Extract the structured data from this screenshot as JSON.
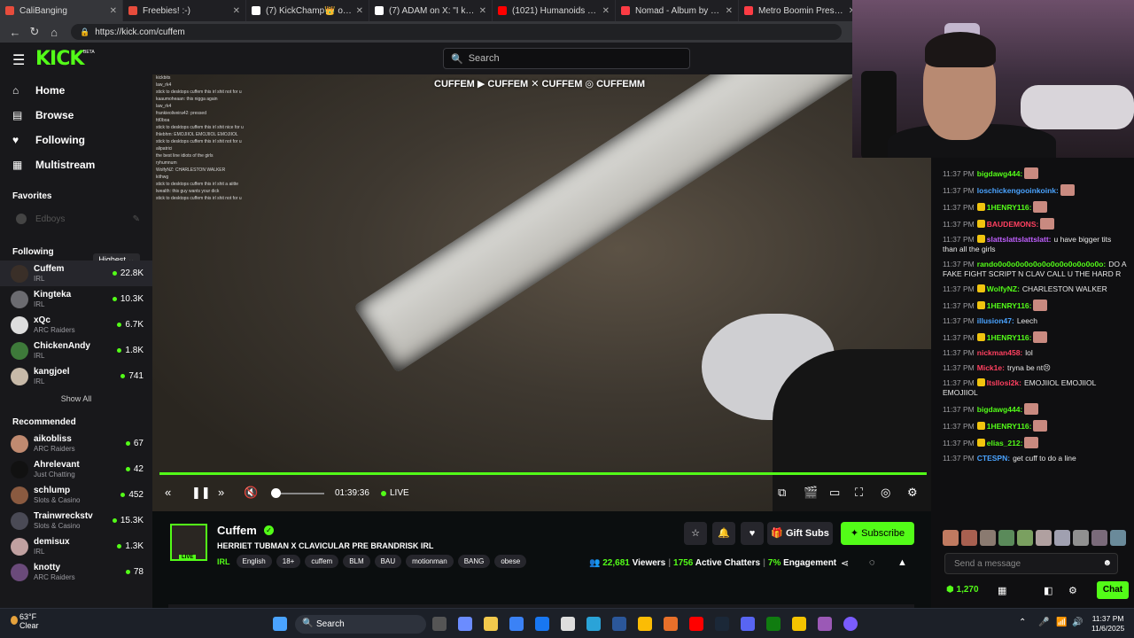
{
  "browser": {
    "tabs": [
      {
        "title": "CaliBanging",
        "color": "#e74c3c"
      },
      {
        "title": "Freebies! :-)",
        "color": "#e74c3c"
      },
      {
        "title": "(7) KickChamp👑 on X: \"A",
        "color": "#ffffff"
      },
      {
        "title": "(7) ADAM on X: \"I knew pe",
        "color": "#ffffff"
      },
      {
        "title": "(1021) Humanoids Cost as",
        "color": "#ff0000"
      },
      {
        "title": "Nomad - Album by DJ Snak",
        "color": "#fc3c44"
      },
      {
        "title": "Metro Boomin Present",
        "color": "#fc3c44"
      }
    ],
    "url": "https://kick.com/cuffem"
  },
  "header": {
    "logo": "KICK",
    "beta": "BETA",
    "search_placeholder": "Search"
  },
  "sidebar": {
    "nav": [
      {
        "label": "Home",
        "icon": "home-icon"
      },
      {
        "label": "Browse",
        "icon": "browse-icon"
      },
      {
        "label": "Following",
        "icon": "heart-icon"
      },
      {
        "label": "Multistream",
        "icon": "grid-icon"
      }
    ],
    "favorites_heading": "Favorites",
    "favorites": [
      {
        "name": "Edboys"
      }
    ],
    "following_heading": "Following",
    "sort_label": "Highest",
    "following": [
      {
        "name": "Cuffem",
        "category": "IRL",
        "viewers": "22.8K",
        "color": "#3a2f28"
      },
      {
        "name": "Kingteka",
        "category": "IRL",
        "viewers": "10.3K",
        "color": "#6b6b70"
      },
      {
        "name": "xQc",
        "category": "ARC Raiders",
        "viewers": "6.7K",
        "color": "#dddddd"
      },
      {
        "name": "ChickenAndy",
        "category": "IRL",
        "viewers": "1.8K",
        "color": "#3e7a3a"
      },
      {
        "name": "kangjoel",
        "category": "IRL",
        "viewers": "741",
        "color": "#c7b9a8"
      }
    ],
    "show_all": "Show All",
    "recommended_heading": "Recommended",
    "recommended": [
      {
        "name": "aikobliss",
        "category": "ARC Raiders",
        "viewers": "67",
        "color": "#c08a70"
      },
      {
        "name": "Ahrelevant",
        "category": "Just Chatting",
        "viewers": "42",
        "color": "#111111"
      },
      {
        "name": "schlump",
        "category": "Slots & Casino",
        "viewers": "452",
        "color": "#8a5a40"
      },
      {
        "name": "Trainwreckstv",
        "category": "Slots & Casino",
        "viewers": "15.3K",
        "color": "#4a4a55"
      },
      {
        "name": "demisux",
        "category": "IRL",
        "viewers": "1.3K",
        "color": "#c0a0a0"
      },
      {
        "name": "knotty",
        "category": "ARC Raiders",
        "viewers": "78",
        "color": "#6a4a7a"
      }
    ]
  },
  "video": {
    "watermark": "CUFFEM ▶ CUFFEM ✕ CUFFEM ◎ CUFFEMM",
    "overlay_lines": [
      "kickbits",
      "law_rk4",
      "stick to desktops cuffem this irl shit not for u",
      "kaaumoheaan: this nigga again",
      "law_rk4",
      "frankieoliveira42: pressed",
      "fd0boa",
      "stick to desktops cuffem this irl shit nice for u",
      "lhlebhm: EMOJIIOL EMOJIIOL EMOJIIOL",
      "stick to desktops cuffem this irl shit not for u",
      "alipatrici",
      "the best line idiots of the girls",
      "ryhumnum",
      "WolfyNZ: CHARLESTON WALKER",
      "kithwg",
      "stick to desktops cuffem this irl shit a aiitte",
      "lwealth: this guy wants your dick",
      "stick to desktops cuffem this irl shit not for u"
    ],
    "time": "01:39:36",
    "live_label": "LIVE",
    "progress": 1.0,
    "volume": 0.0
  },
  "chat": {
    "messages": [
      {
        "time": "11:37 PM",
        "user": "bigdawg444:",
        "color": "#53fc18",
        "text": "",
        "badge": false,
        "emote": true
      },
      {
        "time": "11:37 PM",
        "user": "loschickengooinkoink:",
        "color": "#4aa3ff",
        "text": "",
        "badge": false,
        "emote": true
      },
      {
        "time": "11:37 PM",
        "user": "1HENRY116:",
        "color": "#53fc18",
        "text": "",
        "badge": true,
        "emote": true
      },
      {
        "time": "11:37 PM",
        "user": "BAUDEMONS:",
        "color": "#ff4060",
        "text": "",
        "badge": true,
        "emote": true
      },
      {
        "time": "11:37 PM",
        "user": "slattslattslattslatt:",
        "color": "#c060ff",
        "text": "u have bigger tits than all the girls",
        "badge": true,
        "emote": false
      },
      {
        "time": "11:37 PM",
        "user": "rando0o0o0o0o0o0o0o0o0o0o0o0o:",
        "color": "#53fc18",
        "text": "DO A FAKE FIGHT SCRIPT N CLAV CALL U THE HARD R",
        "badge": false,
        "emote": false
      },
      {
        "time": "11:37 PM",
        "user": "WolfyNZ:",
        "color": "#53fc18",
        "text": "CHARLESTON WALKER",
        "badge": true,
        "emote": false
      },
      {
        "time": "11:37 PM",
        "user": "1HENRY116:",
        "color": "#53fc18",
        "text": "",
        "badge": true,
        "emote": true
      },
      {
        "time": "11:37 PM",
        "user": "illusion47:",
        "color": "#4aa3ff",
        "text": "Leech",
        "badge": false,
        "emote": false
      },
      {
        "time": "11:37 PM",
        "user": "1HENRY116:",
        "color": "#53fc18",
        "text": "",
        "badge": true,
        "emote": true
      },
      {
        "time": "11:37 PM",
        "user": "nickman458:",
        "color": "#ff4060",
        "text": "lol",
        "badge": false,
        "emote": false
      },
      {
        "time": "11:37 PM",
        "user": "Mick1e:",
        "color": "#ff4060",
        "text": "tryna be nt😣",
        "badge": false,
        "emote": false
      },
      {
        "time": "11:37 PM",
        "user": "Itsllosi2k:",
        "color": "#ff4060",
        "text": "EMOJIIOL EMOJIIOL EMOJIIOL",
        "badge": true,
        "emote": false
      },
      {
        "time": "11:37 PM",
        "user": "bigdawg444:",
        "color": "#53fc18",
        "text": "",
        "badge": false,
        "emote": true
      },
      {
        "time": "11:37 PM",
        "user": "1HENRY116:",
        "color": "#53fc18",
        "text": "",
        "badge": true,
        "emote": true
      },
      {
        "time": "11:37 PM",
        "user": "elias_212:",
        "color": "#53fc18",
        "text": "",
        "badge": true,
        "emote": true
      },
      {
        "time": "11:37 PM",
        "user": "CTESPN:",
        "color": "#4aa3ff",
        "text": "get cuff to do a line",
        "badge": false,
        "emote": false
      }
    ],
    "send_placeholder": "Send a message",
    "points": "1,270",
    "chat_button": "Chat"
  },
  "stream": {
    "name": "Cuffem",
    "live_tag": "LIVE",
    "title": "HERRIET TUBMAN X CLAVICULAR PRE BRANDRISK IRL",
    "category": "IRL",
    "tags": [
      "English",
      "18+",
      "cuffem",
      "BLM",
      "BAU",
      "motionman",
      "BANG",
      "obese"
    ],
    "gift_subs": "Gift Subs",
    "subscribe": "Subscribe",
    "viewers": "22,681",
    "viewers_label": "Viewers",
    "chatters": "1756",
    "chatters_label": "Active Chatters",
    "engagement": "7%",
    "engagement_label": "Engagement"
  },
  "taskbar": {
    "temp": "63°F",
    "weather": "Clear",
    "search": "Search",
    "time": "11:37 PM",
    "date": "11/6/2025"
  }
}
